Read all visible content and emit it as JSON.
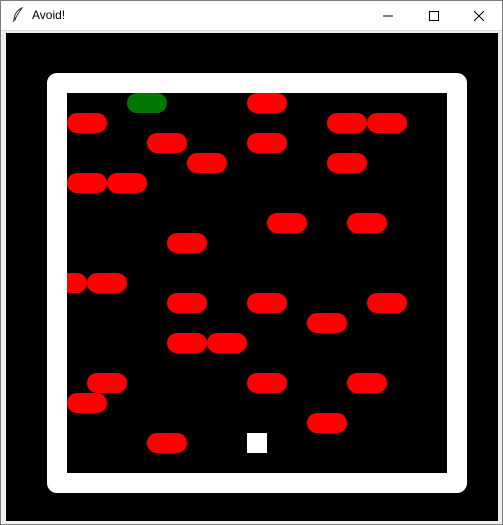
{
  "window": {
    "title": "Avoid!",
    "app_icon": "feather-icon",
    "controls": [
      "minimize-icon",
      "maximize-icon",
      "close-icon"
    ]
  },
  "game": {
    "background_color": "#000000",
    "wall_color": "#ffffff",
    "obstacle_color": "#ff0000",
    "goal_color": "#007800",
    "player_color": "#ffffff",
    "grid": {
      "columns": 19,
      "rows": 19
    },
    "goal": {
      "row": 0,
      "col": 3,
      "length": 2
    },
    "player": {
      "row": 17,
      "col": 9
    },
    "obstacles": [
      {
        "row": 0,
        "col": 9,
        "length": 2
      },
      {
        "row": 1,
        "col": 0,
        "length": 2
      },
      {
        "row": 1,
        "col": 13,
        "length": 2
      },
      {
        "row": 1,
        "col": 15,
        "length": 2
      },
      {
        "row": 2,
        "col": 4,
        "length": 2
      },
      {
        "row": 2,
        "col": 9,
        "length": 2
      },
      {
        "row": 3,
        "col": 6,
        "length": 2
      },
      {
        "row": 3,
        "col": 13,
        "length": 2
      },
      {
        "row": 4,
        "col": 0,
        "length": 2
      },
      {
        "row": 4,
        "col": 2,
        "length": 2
      },
      {
        "row": 6,
        "col": 10,
        "length": 2
      },
      {
        "row": 6,
        "col": 14,
        "length": 2
      },
      {
        "row": 7,
        "col": 5,
        "length": 2
      },
      {
        "row": 9,
        "col": -1,
        "length": 2
      },
      {
        "row": 9,
        "col": 1,
        "length": 2
      },
      {
        "row": 10,
        "col": 5,
        "length": 2
      },
      {
        "row": 10,
        "col": 9,
        "length": 2
      },
      {
        "row": 10,
        "col": 15,
        "length": 2
      },
      {
        "row": 11,
        "col": 12,
        "length": 2
      },
      {
        "row": 12,
        "col": 5,
        "length": 2
      },
      {
        "row": 12,
        "col": 7,
        "length": 2
      },
      {
        "row": 14,
        "col": 1,
        "length": 2
      },
      {
        "row": 14,
        "col": 9,
        "length": 2
      },
      {
        "row": 14,
        "col": 14,
        "length": 2
      },
      {
        "row": 15,
        "col": 0,
        "length": 2
      },
      {
        "row": 16,
        "col": 12,
        "length": 2
      },
      {
        "row": 17,
        "col": 4,
        "length": 2
      }
    ]
  }
}
